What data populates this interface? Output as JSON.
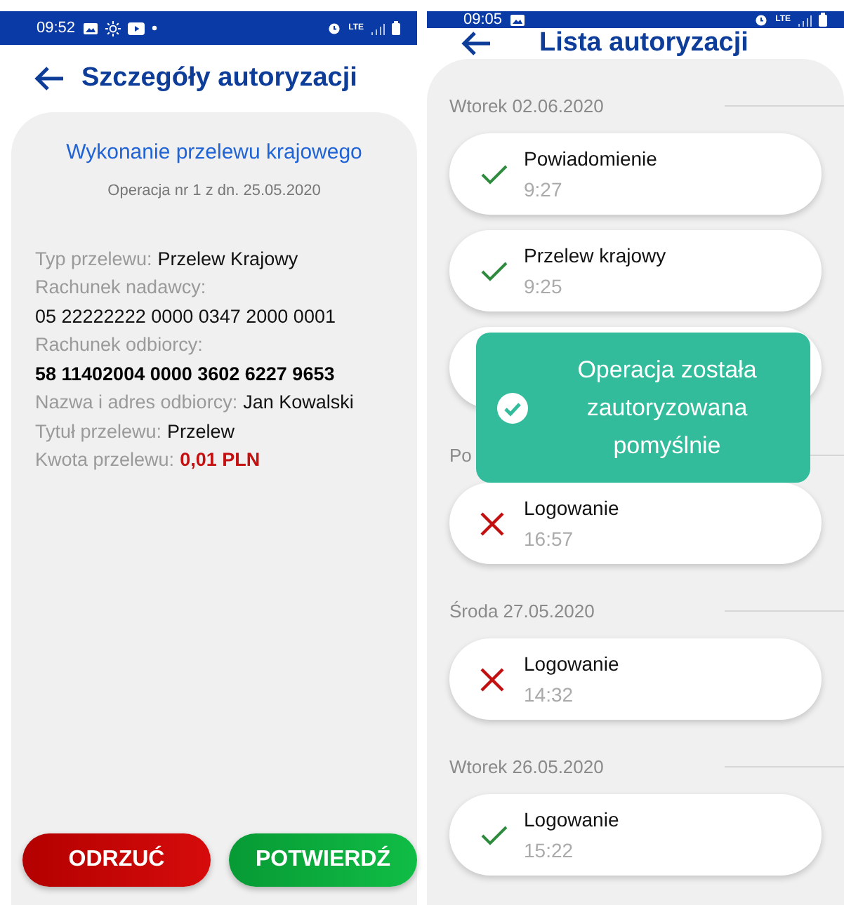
{
  "left_screen": {
    "status_bar": {
      "time": "09:52",
      "network": "LTE"
    },
    "header": {
      "title": "Szczegóły autoryzacji"
    },
    "details": {
      "title": "Wykonanie przelewu krajowego",
      "subtitle": "Operacja nr 1 z dn. 25.05.2020",
      "fields": [
        {
          "label": "Typ przelewu:",
          "value": "Przelew Krajowy",
          "kind": "inline"
        },
        {
          "label": "Rachunek nadawcy:",
          "value": "05 22222222 0000 0347 2000 0001",
          "kind": "stacked"
        },
        {
          "label": "Rachunek odbiorcy:",
          "value": "58 11402004 0000 3602 6227 9653",
          "kind": "stacked_bold"
        },
        {
          "label": "Nazwa i adres odbiorcy:",
          "value": "Jan Kowalski",
          "kind": "inline"
        },
        {
          "label": "Tytuł przelewu:",
          "value": "Przelew",
          "kind": "inline"
        },
        {
          "label": "Kwota przelewu:",
          "value": "0,01 PLN",
          "kind": "amount"
        }
      ]
    },
    "buttons": [
      {
        "label": "ODRZUĆ",
        "kind": "reject"
      },
      {
        "label": "POTWIERDŹ",
        "kind": "confirm"
      }
    ]
  },
  "right_screen": {
    "status_bar": {
      "time": "09:05",
      "network": "LTE"
    },
    "header": {
      "title": "Lista autoryzacji"
    },
    "groups": [
      {
        "date": "Wtorek 02.06.2020",
        "items": [
          {
            "title": "Powiadomienie",
            "time": "9:27",
            "kind": "success"
          },
          {
            "title": "Przelew krajowy",
            "time": "9:25",
            "kind": "success"
          },
          {
            "kind": "covered"
          }
        ]
      },
      {
        "date": "Po",
        "items": [
          {
            "title": "Logowanie",
            "time": "16:57",
            "kind": "failed"
          }
        ]
      },
      {
        "date": "Środa 27.05.2020",
        "items": [
          {
            "title": "Logowanie",
            "time": "14:32",
            "kind": "failed"
          }
        ]
      },
      {
        "date": "Wtorek 26.05.2020",
        "items": [
          {
            "title": "Logowanie",
            "time": "15:22",
            "kind": "success"
          }
        ]
      }
    ],
    "toast": {
      "message": "Operacja została zautoryzowana pomyślnie"
    }
  }
}
